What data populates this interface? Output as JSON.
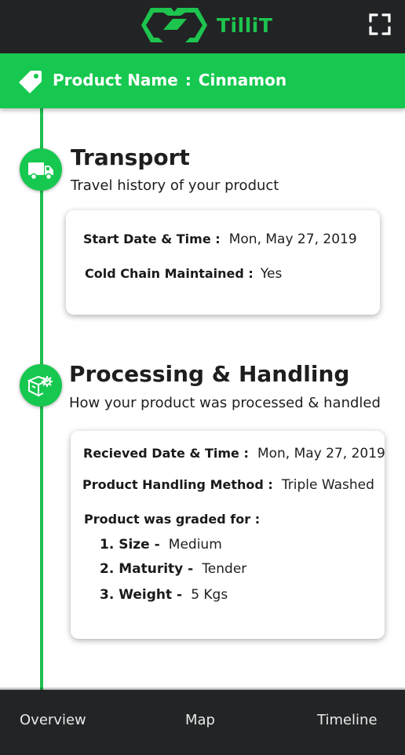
{
  "app": {
    "name": "TilliT",
    "brand_color": "#1dc44e",
    "header_bg": "#222324"
  },
  "header": {
    "expand_icon": "fullscreen-icon"
  },
  "product": {
    "label": "Product Name",
    "separator": ":",
    "name": "Cinnamon",
    "icon": "tag-icon"
  },
  "sections": {
    "transport": {
      "icon": "truck-icon",
      "title": "Transport",
      "subtitle": "Travel history of your product",
      "start_label": "Start Date & Time :",
      "start_value": "Mon, May 27, 2019",
      "cold_label": "Cold Chain Maintained :",
      "cold_value": "Yes"
    },
    "processing": {
      "icon": "box-gear-icon",
      "title": "Processing & Handling",
      "subtitle": "How your product was processed & handled",
      "received_label": "Recieved Date & Time :",
      "received_value": "Mon, May 27, 2019",
      "method_label": "Product Handling Method :",
      "method_value": "Triple Washed",
      "graded_label": "Product was graded for :",
      "grades": [
        {
          "label": "1. Size -",
          "value": "Medium"
        },
        {
          "label": "2. Maturity -",
          "value": "Tender"
        },
        {
          "label": "3. Weight -",
          "value": "5 Kgs"
        }
      ]
    }
  },
  "bottom_nav": {
    "items": [
      "Overview",
      "Map",
      "Timeline"
    ]
  }
}
